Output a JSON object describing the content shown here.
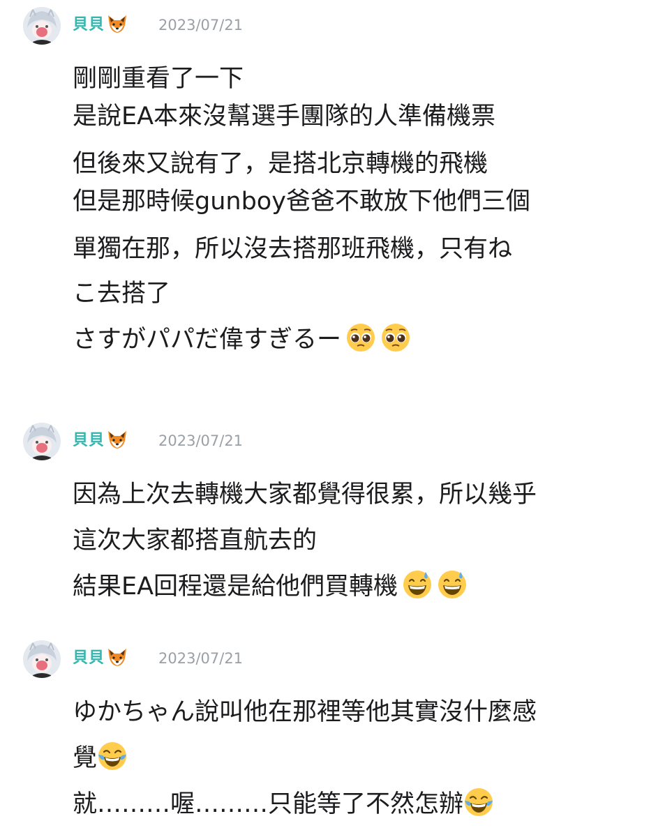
{
  "posts": [
    {
      "author": "貝貝",
      "author_emoji": "fox-icon",
      "date": "2023/07/21",
      "lines": [
        "剛剛重看了一下",
        "是說EA本來沒幫選手團隊的人準備機票",
        "但後來又說有了，是搭北京轉機的飛機",
        "但是那時候gunboy爸爸不敢放下他們三個",
        "單獨在那，所以沒去搭那班飛機，只有ね",
        "こ去搭了",
        "さすがパパだ偉すぎるー"
      ],
      "trailing_emojis": [
        "pleading-face-icon",
        "pleading-face-icon"
      ]
    },
    {
      "author": "貝貝",
      "author_emoji": "fox-icon",
      "date": "2023/07/21",
      "lines": [
        "因為上次去轉機大家都覺得很累，所以幾乎",
        "這次大家都搭直航去的",
        "結果EA回程還是給他們買轉機"
      ],
      "trailing_emojis": [
        "grinning-sweat-icon",
        "grinning-sweat-icon"
      ]
    },
    {
      "author": "貝貝",
      "author_emoji": "fox-icon",
      "date": "2023/07/21",
      "lines": [
        "ゆかちゃん說叫他在那裡等他其實沒什麼感",
        "覺",
        "就………喔………只能等了不然怎辦"
      ],
      "line_emojis": {
        "1": "tears-of-joy-icon",
        "2": "tears-of-joy-icon"
      }
    }
  ],
  "colors": {
    "author": "#35b6ae",
    "date": "#9aa0a6",
    "text": "#1c1c1e",
    "background": "#ffffff"
  }
}
